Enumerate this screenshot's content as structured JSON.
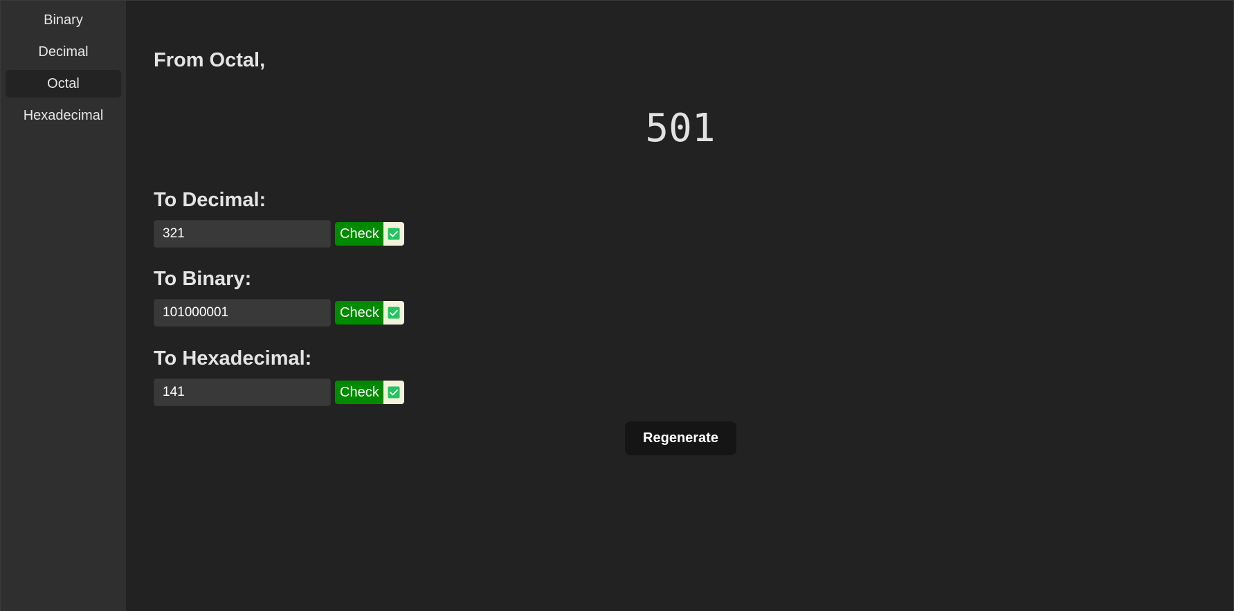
{
  "sidebar": {
    "items": [
      {
        "label": "Binary"
      },
      {
        "label": "Decimal"
      },
      {
        "label": "Octal"
      },
      {
        "label": "Hexadecimal"
      }
    ],
    "active": "Octal"
  },
  "main": {
    "heading": "From Octal,",
    "number": "501",
    "sections": [
      {
        "label": "To Decimal:",
        "value": "321",
        "check_label": "Check",
        "checked": true
      },
      {
        "label": "To Binary:",
        "value": "101000001",
        "check_label": "Check",
        "checked": true
      },
      {
        "label": "To Hexadecimal:",
        "value": "141",
        "check_label": "Check",
        "checked": true
      }
    ],
    "regenerate_label": "Regenerate"
  },
  "colors": {
    "background": "#222222",
    "sidebar": "#2f2f2f",
    "check_green": "#008a00",
    "checkmark_green": "#22c55e",
    "regenerate_bg": "#151515"
  },
  "icons": {
    "checkbox": "checkbox-checked-icon"
  }
}
